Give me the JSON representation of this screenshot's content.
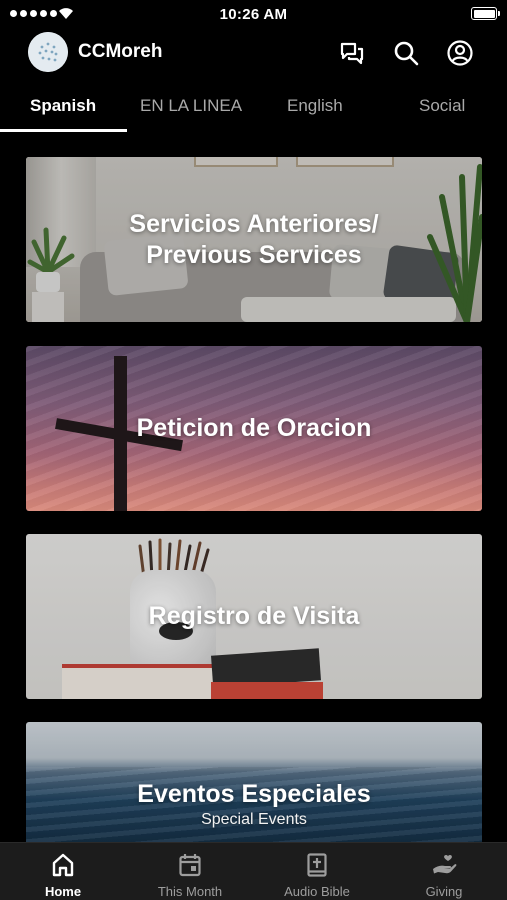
{
  "status_bar": {
    "time": "10:26 AM",
    "battery_level": 1.0
  },
  "header": {
    "app_name": "CCMoreh",
    "icons": [
      "chat-icon",
      "search-icon",
      "account-icon"
    ]
  },
  "tabs": [
    {
      "label": "Spanish",
      "active": true
    },
    {
      "label": "EN LA LINEA",
      "active": false
    },
    {
      "label": "English",
      "active": false
    },
    {
      "label": "Social",
      "active": false
    }
  ],
  "cards": [
    {
      "title_line1": "Servicios Anteriores/",
      "title_line2": "Previous Services",
      "subtitle": ""
    },
    {
      "title_line1": "Peticion de Oracion",
      "title_line2": "",
      "subtitle": ""
    },
    {
      "title_line1": "Registro de Visita",
      "title_line2": "",
      "subtitle": ""
    },
    {
      "title_line1": "Eventos Especiales",
      "title_line2": "",
      "subtitle": "Special Events"
    }
  ],
  "bottom_nav": [
    {
      "label": "Home",
      "icon": "home-icon",
      "active": true
    },
    {
      "label": "This Month",
      "icon": "calendar-icon",
      "active": false
    },
    {
      "label": "Audio Bible",
      "icon": "bible-icon",
      "active": false
    },
    {
      "label": "Giving",
      "icon": "giving-hand-icon",
      "active": false
    }
  ]
}
